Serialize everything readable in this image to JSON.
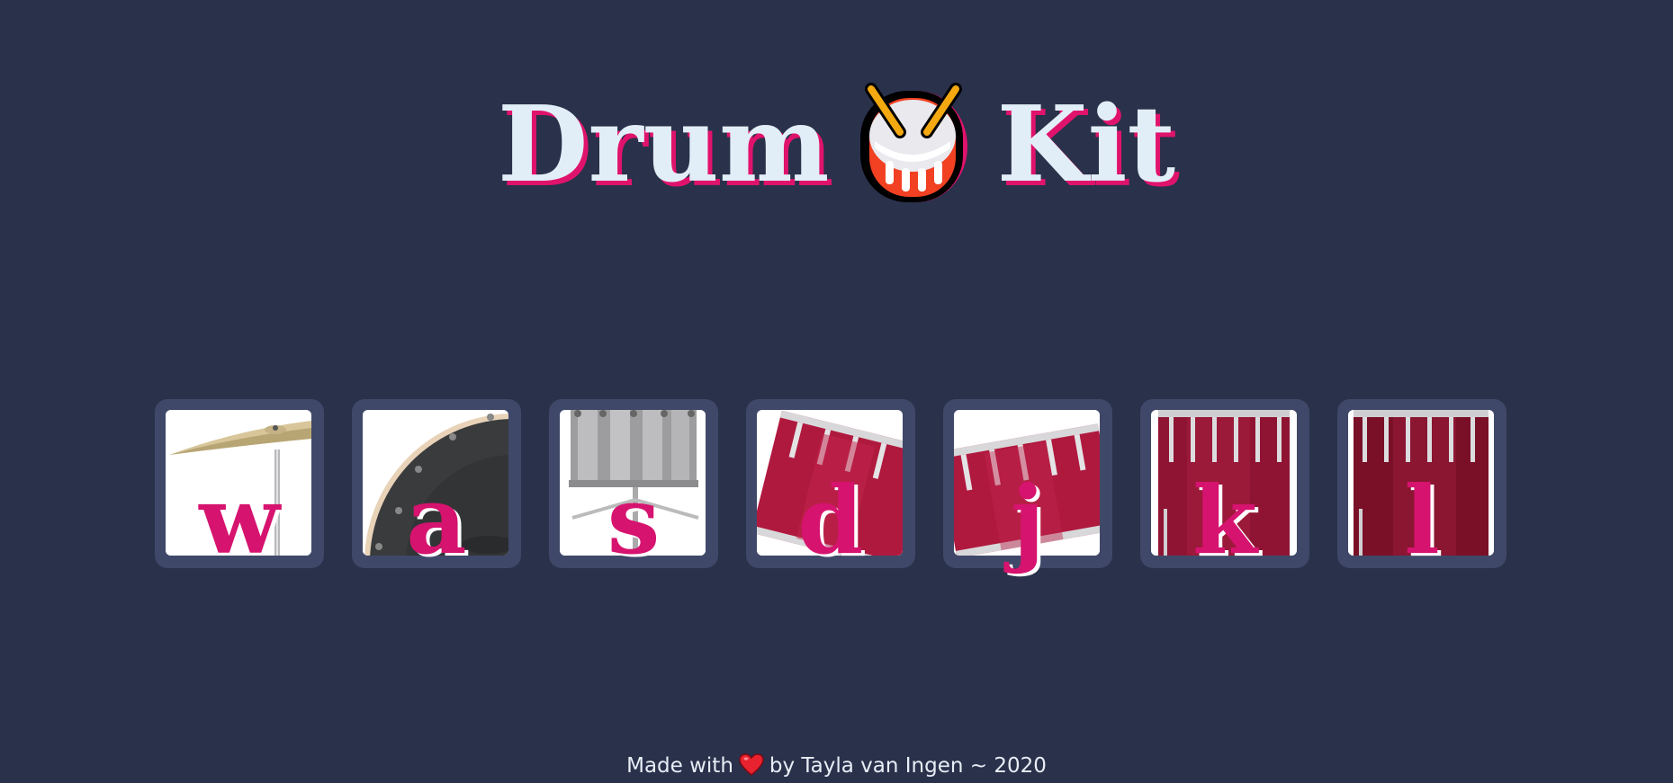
{
  "title": {
    "before": "Drum",
    "icon": "drum-emoji-icon",
    "after": "Kit"
  },
  "pads": [
    {
      "key": "w",
      "image": "cymbal-icon"
    },
    {
      "key": "a",
      "image": "bass-drum-icon"
    },
    {
      "key": "s",
      "image": "snare-drum-icon"
    },
    {
      "key": "d",
      "image": "tom-drum-icon"
    },
    {
      "key": "j",
      "image": "tom-drum-icon"
    },
    {
      "key": "k",
      "image": "floor-tom-icon"
    },
    {
      "key": "l",
      "image": "floor-tom-icon"
    }
  ],
  "footer": {
    "prefix": "Made with",
    "icon": "heart-icon",
    "suffix": "by Tayla van Ingen ~ 2020"
  },
  "colors": {
    "background": "#2a314b",
    "pad_border": "#3f4868",
    "title_text": "#e2eef7",
    "accent": "#d6136f"
  }
}
